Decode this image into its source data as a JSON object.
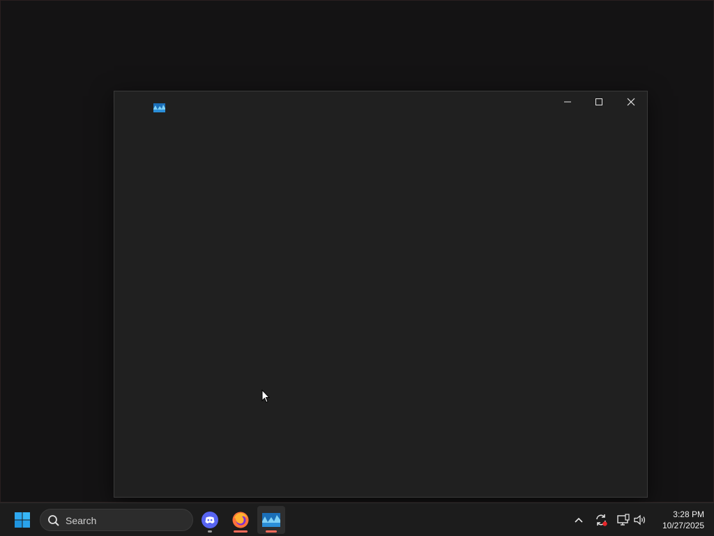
{
  "desktop": {
    "background_color": "#141314"
  },
  "window": {
    "background_color": "#202020",
    "icon": "photos-app-icon",
    "controls": {
      "minimize": "minimize-icon",
      "maximize": "maximize-icon",
      "close": "close-icon"
    }
  },
  "taskbar": {
    "start_icon": "windows-start-icon",
    "search": {
      "label": "Search",
      "icon": "search-icon"
    },
    "apps": [
      {
        "name": "discord",
        "icon": "discord-icon",
        "color": "#5865F2"
      },
      {
        "name": "firefox",
        "icon": "firefox-icon",
        "color": "#FF7139"
      },
      {
        "name": "photos",
        "icon": "photos-app-icon",
        "color": "#4AA3DF",
        "active": true
      }
    ],
    "tray": {
      "overflow_icon": "chevron-up-icon",
      "sync_icon": "sync-icon",
      "network_icon": "network-icon",
      "volume_icon": "volume-icon"
    },
    "clock": {
      "time": "3:28 PM",
      "date": "10/27/2025"
    },
    "accent_color": "#ff6b5a"
  }
}
